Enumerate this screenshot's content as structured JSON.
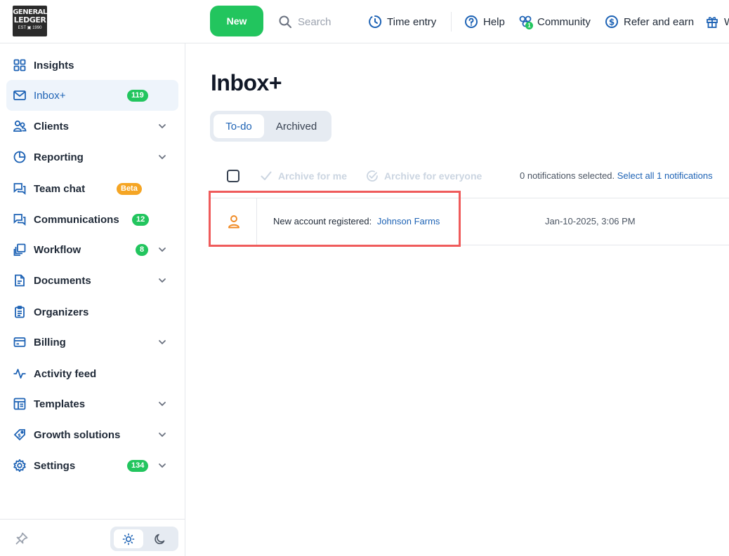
{
  "brand": {
    "logo_line1": "GENERAL",
    "logo_line2": "LEDGER",
    "logo_line3": "EST  ▣  1990"
  },
  "topbar": {
    "new_label": "New",
    "search_placeholder": "Search",
    "time_entry": "Time entry",
    "help": "Help",
    "community": "Community",
    "community_count": "1",
    "refer": "Refer and earn",
    "whats_new_partial": "W"
  },
  "sidebar": {
    "items": [
      {
        "label": "Insights"
      },
      {
        "label": "Inbox+",
        "badge": "119"
      },
      {
        "label": "Clients"
      },
      {
        "label": "Reporting"
      },
      {
        "label": "Team chat",
        "badge": "Beta"
      },
      {
        "label": "Communications",
        "badge": "12"
      },
      {
        "label": "Workflow",
        "badge": "8"
      },
      {
        "label": "Documents"
      },
      {
        "label": "Organizers"
      },
      {
        "label": "Billing"
      },
      {
        "label": "Activity feed"
      },
      {
        "label": "Templates"
      },
      {
        "label": "Growth solutions"
      },
      {
        "label": "Settings",
        "badge": "134"
      }
    ]
  },
  "main": {
    "title": "Inbox+",
    "tabs": [
      {
        "label": "To-do"
      },
      {
        "label": "Archived"
      }
    ],
    "actions": {
      "archive_me": "Archive for me",
      "archive_everyone": "Archive for everyone"
    },
    "selection": {
      "text": "0 notifications selected.",
      "link": "Select all 1 notifications"
    },
    "notifications": [
      {
        "message": "New account registered:",
        "client": "Johnson Farms",
        "timestamp": "Jan-10-2025, 3:06 PM"
      }
    ]
  },
  "colors": {
    "accent": "#1e63b5",
    "success": "#22c55e",
    "beta": "#f5a524",
    "highlight": "#ef5b5b"
  }
}
